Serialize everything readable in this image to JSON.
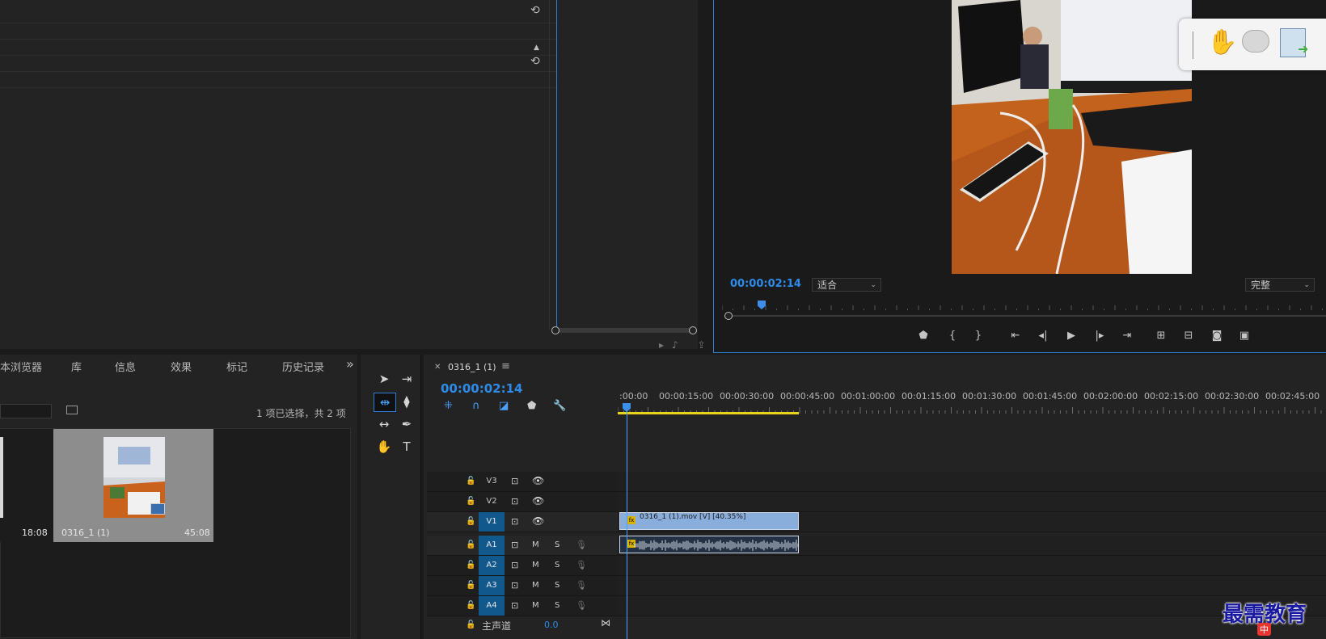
{
  "program_monitor": {
    "timecode": "00:00:02:14",
    "zoom_select": "适合",
    "quality_select": "完整"
  },
  "project_panel": {
    "tabs": [
      "本浏览器",
      "库",
      "信息",
      "效果",
      "标记",
      "历史记录"
    ],
    "selection_count": "1 项已选择，共 2 项",
    "clips": [
      {
        "name": "",
        "duration": "18:08"
      },
      {
        "name": "0316_1 (1)",
        "duration": "45:08"
      }
    ]
  },
  "timeline": {
    "sequence_name": "0316_1 (1)",
    "timecode": "00:00:02:14",
    "ruler_labels": [
      ":00:00",
      "00:00:15:00",
      "00:00:30:00",
      "00:00:45:00",
      "00:01:00:00",
      "00:01:15:00",
      "00:01:30:00",
      "00:01:45:00",
      "00:02:00:00",
      "00:02:15:00",
      "00:02:30:00",
      "00:02:45:00"
    ],
    "video_tracks": [
      "V3",
      "V2",
      "V1"
    ],
    "audio_tracks": [
      "A1",
      "A2",
      "A3",
      "A4"
    ],
    "mute_label": "M",
    "solo_label": "S",
    "fx_label": "fx",
    "video_clip_title": "0316_1 (1).mov [V] [40.35%]",
    "master_label": "主声道",
    "master_value": "0.0"
  },
  "watermark": {
    "text": "最需教育",
    "sub": "中"
  },
  "colors": {
    "accent_blue": "#2d8ceb",
    "track_active": "#11598d",
    "video_clip": "#8aaedc",
    "work_area": "#e6d51b"
  },
  "icons": {
    "floating_toolbar": [
      "hand-icon",
      "comment-icon",
      "export-doc-icon"
    ],
    "transport": [
      "marker-icon",
      "mark-in-icon",
      "mark-out-icon",
      "go-to-in-icon",
      "step-back-icon",
      "play-icon",
      "step-forward-icon",
      "go-to-out-icon",
      "lift-icon",
      "extract-icon",
      "camera-icon",
      "compare-icon"
    ],
    "tools": [
      "selection-tool",
      "track-select-tool",
      "ripple-edit-tool",
      "razor-tool",
      "slip-tool",
      "pen-tool",
      "hand-tool",
      "type-tool"
    ]
  }
}
